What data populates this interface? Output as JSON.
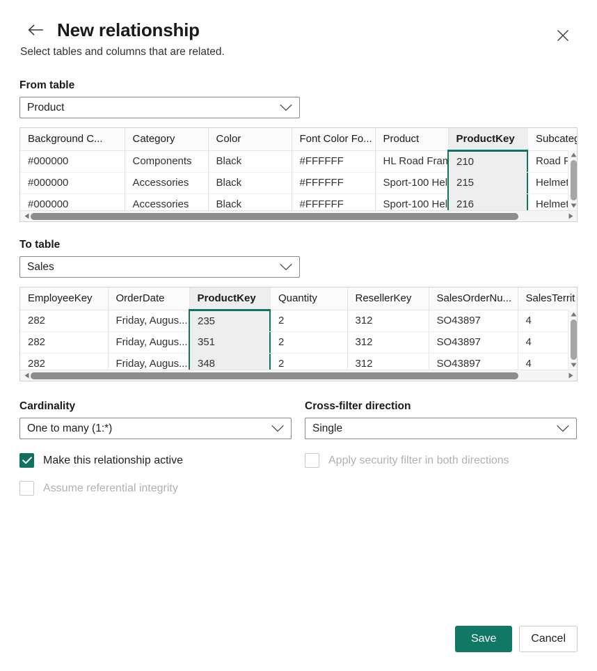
{
  "header": {
    "title": "New relationship",
    "subtitle": "Select tables and columns that are related.",
    "back_icon": "arrow-left-icon",
    "close_icon": "close-icon"
  },
  "from_table": {
    "label": "From table",
    "value": "Product",
    "chevron_icon": "chevron-down-icon",
    "grid": {
      "columns": [
        "Background C...",
        "Category",
        "Color",
        "Font Color Fo...",
        "Product",
        "ProductKey",
        "Subcategory"
      ],
      "selected_column": "ProductKey",
      "rows": [
        [
          "#000000",
          "Components",
          "Black",
          "#FFFFFF",
          "HL Road Fram...",
          "210",
          "Road Fra"
        ],
        [
          "#000000",
          "Accessories",
          "Black",
          "#FFFFFF",
          "Sport-100 Hel...",
          "215",
          "Helmets"
        ],
        [
          "#000000",
          "Accessories",
          "Black",
          "#FFFFFF",
          "Sport-100 Hel...",
          "216",
          "Helmets"
        ]
      ]
    }
  },
  "to_table": {
    "label": "To table",
    "value": "Sales",
    "chevron_icon": "chevron-down-icon",
    "grid": {
      "columns": [
        "EmployeeKey",
        "OrderDate",
        "ProductKey",
        "Quantity",
        "ResellerKey",
        "SalesOrderNu...",
        "SalesTerrit"
      ],
      "selected_column": "ProductKey",
      "rows": [
        [
          "282",
          "Friday, Augus...",
          "235",
          "2",
          "312",
          "SO43897",
          "4"
        ],
        [
          "282",
          "Friday, Augus...",
          "351",
          "2",
          "312",
          "SO43897",
          "4"
        ],
        [
          "282",
          "Friday, Augus...",
          "348",
          "2",
          "312",
          "SO43897",
          "4"
        ]
      ]
    }
  },
  "cardinality": {
    "label": "Cardinality",
    "value": "One to many (1:*)",
    "chevron_icon": "chevron-down-icon"
  },
  "cross_filter": {
    "label": "Cross-filter direction",
    "value": "Single",
    "chevron_icon": "chevron-down-icon"
  },
  "checkboxes": {
    "active": {
      "label": "Make this relationship active",
      "checked": true,
      "disabled": false
    },
    "security_filter": {
      "label": "Apply security filter in both directions",
      "checked": false,
      "disabled": true
    },
    "referential_integrity": {
      "label": "Assume referential integrity",
      "checked": false,
      "disabled": true
    }
  },
  "footer": {
    "save_label": "Save",
    "cancel_label": "Cancel"
  },
  "colors": {
    "accent": "#117865",
    "selection_border": "#0f7462",
    "checkbox_checked": "#12715e",
    "selected_cell_bg": "#efeeee",
    "disabled_text": "#b3b0ad"
  }
}
